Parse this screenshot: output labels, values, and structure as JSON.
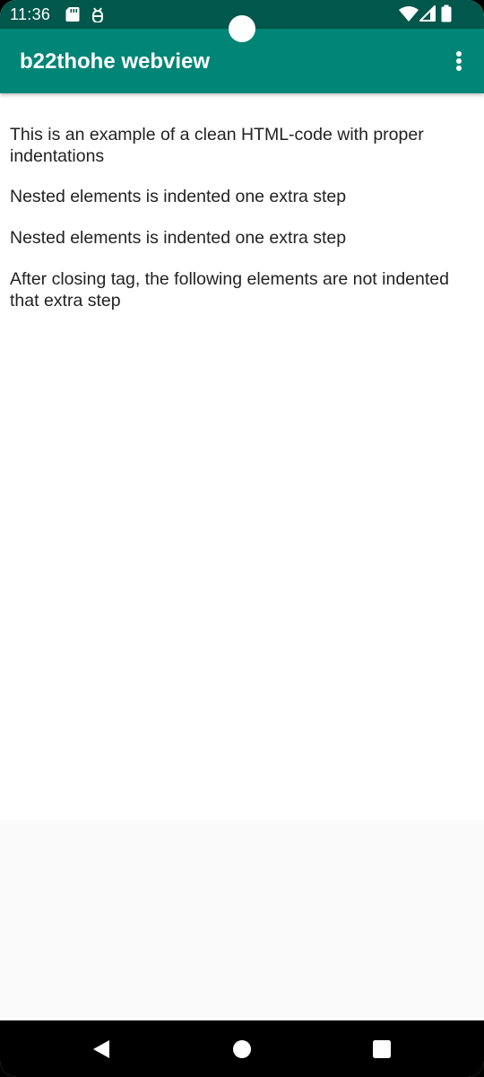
{
  "status_bar": {
    "time": "11:36",
    "icons": [
      "sd-card-icon",
      "android-debug-icon",
      "wifi-icon",
      "signal-icon",
      "battery-icon"
    ]
  },
  "app_bar": {
    "title": "b22thohe webview",
    "menu_icon": "more-vert-icon"
  },
  "webview": {
    "paragraphs": [
      "This is an example of a clean HTML-code with proper indentations",
      "Nested elements is indented one extra step",
      "Nested elements is indented one extra step",
      "After closing tag, the following elements are not indented that extra step"
    ]
  },
  "nav_bar": {
    "icons": [
      "back-icon",
      "home-icon",
      "recents-icon"
    ]
  },
  "colors": {
    "status_bar": "#00574b",
    "app_bar": "#008577",
    "content_bg": "#ffffff",
    "below_content_bg": "#fafafa",
    "nav_bar": "#000000"
  }
}
